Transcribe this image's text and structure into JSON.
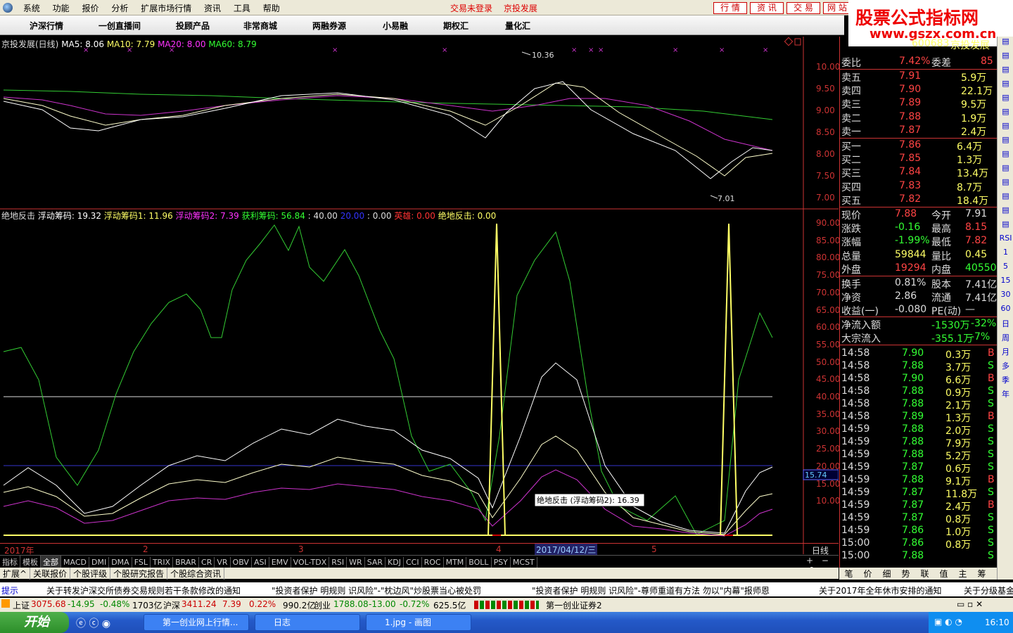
{
  "menu": {
    "items": [
      "系统",
      "功能",
      "报价",
      "分析",
      "扩展市场行情",
      "资讯",
      "工具",
      "帮助"
    ],
    "status_login": "交易未登录",
    "status_broker": "京投发展",
    "buttons": [
      "行 情",
      "资 讯",
      "交 易",
      "网 站"
    ]
  },
  "nav": {
    "items": [
      "沪深行情",
      "一创直播间",
      "投顾产品",
      "非常商城",
      "两融券源",
      "小易融",
      "期权汇",
      "量化汇"
    ]
  },
  "banner": {
    "line1": "股票公式指标网",
    "line2": "www.gszx.com.cn"
  },
  "ma": {
    "label": "京投发展(日线)",
    "ma5": "MA5: 8.06",
    "ma10": "MA10: 7.79",
    "ma20": "MA20: 8.00",
    "ma60": "MA60: 8.79"
  },
  "indicator": {
    "name": "绝地反击",
    "fd": "浮动筹码: 19.32",
    "fd1": "浮动筹码1: 11.96",
    "fd2": "浮动筹码2: 7.39",
    "hl": "获利筹码: 56.84",
    "v40": ": 40.00",
    "v20": "20.00",
    "v20b": ": 0.00",
    "yx": "英雄: 0.00",
    "jd": "绝地反击: 0.00"
  },
  "price_axis": [
    "10.00",
    "9.50",
    "9.00",
    "8.50",
    "8.00",
    "7.50",
    "7.00"
  ],
  "ind_axis": [
    "90.00",
    "85.00",
    "80.00",
    "75.00",
    "70.00",
    "65.00",
    "60.00",
    "55.00",
    "50.00",
    "45.00",
    "40.00",
    "35.00",
    "30.00",
    "25.00",
    "20.00",
    "15.00",
    "10.00"
  ],
  "hi_label": "10.36",
  "lo_label": "7.01",
  "cursor_value": "15.74",
  "tooltip": "绝地反击 (浮动筹码2): 16.39",
  "dates": {
    "d0": "2017年",
    "d1": "2",
    "d2": "3",
    "d3": "4",
    "d4": "5",
    "cursor": "2017/04/12/三",
    "period": "日线"
  },
  "tabs": [
    "指标",
    "模板",
    "全部",
    "MACD",
    "DMI",
    "DMA",
    "FSL",
    "TRIX",
    "BRAR",
    "CR",
    "VR",
    "OBV",
    "ASI",
    "EMV",
    "VOL-TDX",
    "RSI",
    "WR",
    "SAR",
    "KDJ",
    "CCI",
    "ROC",
    "MTM",
    "BOLL",
    "PSY",
    "MCST"
  ],
  "tabs2": [
    "扩展^",
    "关联报价",
    "个股评级",
    "个股研究报告",
    "个股综合资讯"
  ],
  "stock": {
    "code": "600683",
    "name": "京投发展"
  },
  "order": {
    "wb": "委比",
    "wb_v": "7.42%",
    "wc": "委差",
    "wc_v": "85",
    "sells": [
      [
        "卖五",
        "7.91",
        "5.9万"
      ],
      [
        "卖四",
        "7.90",
        "22.1万"
      ],
      [
        "卖三",
        "7.89",
        "9.5万"
      ],
      [
        "卖二",
        "7.88",
        "1.9万"
      ],
      [
        "卖一",
        "7.87",
        "2.4万"
      ]
    ],
    "buys": [
      [
        "买一",
        "7.86",
        "6.4万"
      ],
      [
        "买二",
        "7.85",
        "1.3万"
      ],
      [
        "买三",
        "7.84",
        "13.4万"
      ],
      [
        "买四",
        "7.83",
        "8.7万"
      ],
      [
        "买五",
        "7.82",
        "18.4万"
      ]
    ]
  },
  "quote": [
    [
      "现价",
      "7.88",
      "今开",
      "7.91"
    ],
    [
      "涨跌",
      "-0.16",
      "最高",
      "8.15"
    ],
    [
      "涨幅",
      "-1.99%",
      "最低",
      "7.82"
    ],
    [
      "总量",
      "59844",
      "量比",
      "0.45"
    ],
    [
      "外盘",
      "19294",
      "内盘",
      "40550"
    ],
    [
      "换手",
      "0.81%",
      "股本",
      "7.41亿"
    ],
    [
      "净资",
      "2.86",
      "流通",
      "7.41亿"
    ],
    [
      "收益(一)",
      "-0.080",
      "PE(动)",
      "—"
    ]
  ],
  "flow": [
    [
      "净流入额",
      "-1530万",
      "-32%"
    ],
    [
      "大宗流入",
      "-355.1万",
      "-7%"
    ]
  ],
  "ticks": [
    [
      "14:58",
      "7.90",
      "0.3万",
      "B"
    ],
    [
      "14:58",
      "7.88",
      "3.7万",
      "S"
    ],
    [
      "14:58",
      "7.90",
      "6.6万",
      "B"
    ],
    [
      "14:58",
      "7.88",
      "0.9万",
      "S"
    ],
    [
      "14:58",
      "7.88",
      "2.1万",
      "S"
    ],
    [
      "14:58",
      "7.89",
      "1.3万",
      "B"
    ],
    [
      "14:59",
      "7.88",
      "2.0万",
      "S"
    ],
    [
      "14:59",
      "7.88",
      "7.9万",
      "S"
    ],
    [
      "14:59",
      "7.88",
      "5.2万",
      "S"
    ],
    [
      "14:59",
      "7.87",
      "0.6万",
      "S"
    ],
    [
      "14:59",
      "7.88",
      "9.1万",
      "B"
    ],
    [
      "14:59",
      "7.87",
      "11.8万",
      "S"
    ],
    [
      "14:59",
      "7.87",
      "2.4万",
      "B"
    ],
    [
      "14:59",
      "7.87",
      "0.8万",
      "S"
    ],
    [
      "14:59",
      "7.86",
      "1.0万",
      "S"
    ],
    [
      "15:00",
      "7.86",
      "0.8万",
      "S"
    ],
    [
      "15:00",
      "7.88",
      "",
      "S"
    ]
  ],
  "rptabs": [
    "笔",
    "价",
    "细",
    "势",
    "联",
    "值",
    "主",
    "筹"
  ],
  "side": [
    "RSI",
    "1",
    "5",
    "15",
    "30",
    "60",
    "日",
    "周",
    "月",
    "多",
    "季",
    "年"
  ],
  "ticker": {
    "label": "提示",
    "n1": "关于转发沪深交所债券交易规则若干条款修改的通知",
    "n2": "\"投资者保护 明规则 识风险\"-\"枕边风\"炒股票当心被处罚",
    "n3": "\"投资者保护 明规则 识风险\"-尊师重道有方法 勿以\"内幕\"报师恩",
    "n4": "关于2017年全年休市安排的通知",
    "n5": "关于分级基金"
  },
  "indexbar": {
    "sh": "上证",
    "sh_v": "3075.68",
    "sh_c": "-14.95",
    "sh_p": "-0.48%",
    "sh_a": "1703亿",
    "hs": "沪深",
    "hs_v": "3411.24",
    "hs_c": "7.39",
    "hs_p": "0.22%",
    "hs_a": "990.2亿",
    "cy": "创业",
    "cy_v": "1788.08",
    "cy_c": "-13.00",
    "cy_p": "-0.72%",
    "cy_a": "625.5亿",
    "broker": "第一创业证券2"
  },
  "taskbar": {
    "start": "开始",
    "t1": "第一创业网上行情...",
    "t2": "日志",
    "t3": "1.jpg - 画图",
    "time": "16:10"
  }
}
